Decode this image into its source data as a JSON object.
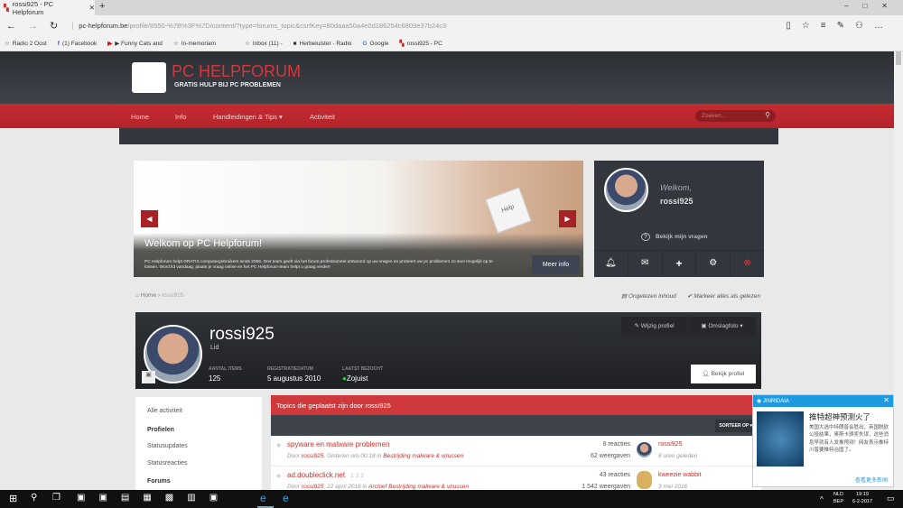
{
  "browser": {
    "tab_title": "rossi925 - PC Helpforum",
    "url_domain": "pc-helpforum.be",
    "url_path": "/profile/8550-%7B%3F%7D/content/?type=forums_topic&csrfKey=80daaa50a4e0d186254c6809e37b24c3",
    "favorites": [
      "Radio 2 Oost",
      "(1) Facebook",
      "▶ Funny Cats and",
      "In-memoriam",
      "Inbox (11) -",
      "Herbeluister - Radio",
      "Google",
      "rossi925 - PC"
    ]
  },
  "site": {
    "logo_title": "PC HELPFORUM",
    "logo_subtitle": "GRATIS HULP BIJ PC PROBLEMEN",
    "nav": [
      "Home",
      "Info",
      "Handleidingen & Tips ▾",
      "Activiteit"
    ],
    "search_placeholder": "Zoeken..."
  },
  "banner": {
    "title": "Welkom op PC Helpforum!",
    "text": "PC Helpforum helpt GRATIS computergebruikers sinds 2006. Ons team geeft via het forum professioneel antwoord op uw vragen en probeert uw pc problemen zo snel mogelijk op te lossen. Word lid vandaag, plaats je vraag online en het PC Helpforum-team helpt u graag verder!",
    "button": "Meer info",
    "key_label": "Help"
  },
  "welcome": {
    "greeting": "Welkom,",
    "username": "rossi925",
    "questions_link": "Bekijk mijn vragen"
  },
  "breadcrumb": {
    "home": "Home",
    "current": "rossi925",
    "unread": "Ongelezen inhoud",
    "mark_read": "Markeer alles als gelezen"
  },
  "profile": {
    "name": "rossi925",
    "role": "Lid",
    "edit": "Wijzig profiel",
    "cover": "Omslagfoto ▾",
    "view": "Bekijk profiel",
    "stats": [
      {
        "label": "AANTAL ITEMS",
        "value": "125"
      },
      {
        "label": "REGISTRATIEDATUM",
        "value": "5 augustus 2010"
      },
      {
        "label": "LAATST BEZOCHT",
        "value": "Zojuist"
      }
    ]
  },
  "leftnav": [
    {
      "label": "Alle activiteit",
      "bold": false
    },
    {
      "label": "Profielen",
      "bold": true
    },
    {
      "label": "Statusupdates",
      "bold": false
    },
    {
      "label": "Statusreacties",
      "bold": false
    },
    {
      "label": "Forums",
      "bold": true
    }
  ],
  "topics": {
    "header": "Topics die geplaatst zijn door rossi925",
    "sort": "SORTEER OP ▾",
    "rows": [
      {
        "title": "spyware en malware problemen",
        "pages": [],
        "by": "Door",
        "author": "rossi925",
        "date": ", Gisteren om 00:18 in",
        "forum": "Bestrijding malware & virussen",
        "replies": "8 reacties",
        "views": "62 weergaven",
        "last_user": "rossi925",
        "last_time": "8 uren geleden"
      },
      {
        "title": "ad.doubleclick.net",
        "pages": [
          "1",
          "2",
          "3"
        ],
        "by": "Door",
        "author": "rossi925",
        "date": ", 22 april 2016 in",
        "forum": "Archief Bestrijding malware & virussen",
        "replies": "43 reacties",
        "views": "1.542 weergaven",
        "last_user": "kweezie wabbit",
        "last_time": "3 mei 2016"
      }
    ]
  },
  "notification": {
    "app": "JINRIDAIA",
    "headline": "推特超神预测火了",
    "body": "美国大选中特朗普会胜出，英国脱欧公投结果，奥斯卡颁奖失误，这些消息早就有人发推预测！网友表示推特川普要推特治国了。",
    "more": "查看更多新闻"
  },
  "taskbar": {
    "lang1": "NLD",
    "lang2": "BEP",
    "time": "19:19",
    "date": "6-2-2017"
  },
  "colors": {
    "brand_red": "#c1272d",
    "dark": "#33363c"
  }
}
